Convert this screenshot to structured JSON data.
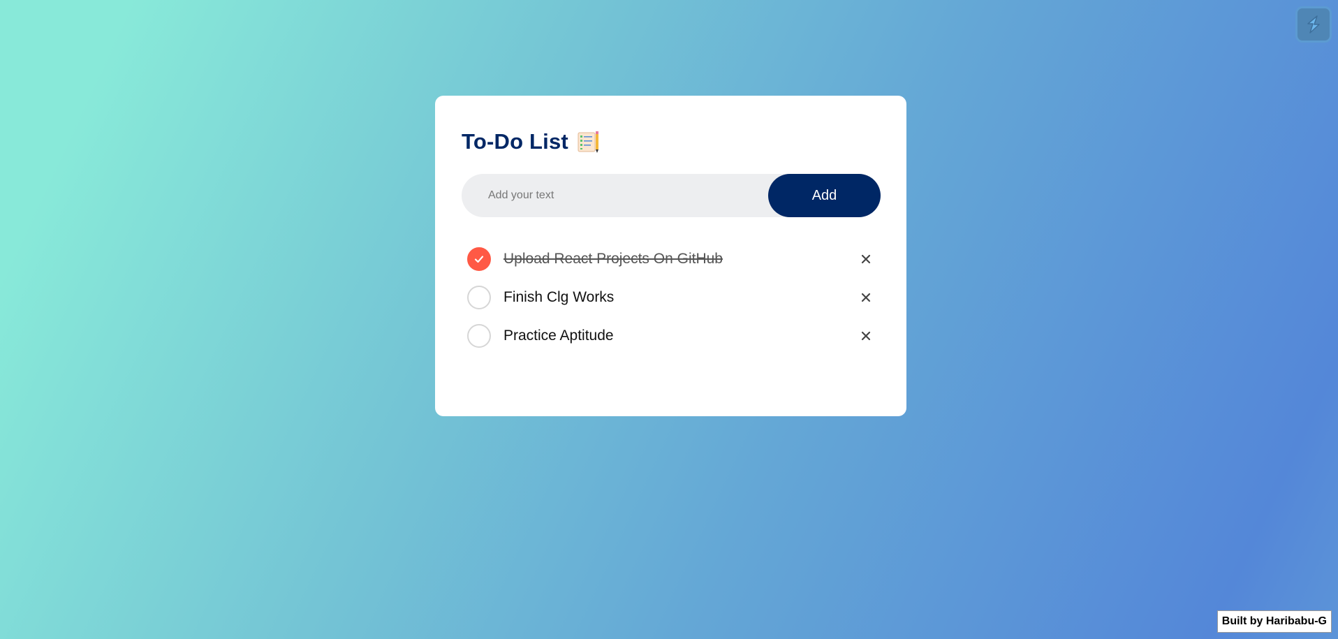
{
  "header": {
    "title": "To-Do List",
    "title_icon": "notepad-pencil-icon"
  },
  "form": {
    "placeholder": "Add your text",
    "value": "",
    "add_label": "Add"
  },
  "tasks": [
    {
      "text": "Upload React Projects On GitHub",
      "completed": true
    },
    {
      "text": "Finish Clg Works",
      "completed": false
    },
    {
      "text": "Practice Aptitude",
      "completed": false
    }
  ],
  "floating_button": {
    "icon": "lightning-logo-icon"
  },
  "footer": {
    "credit": "Built by Haribabu-G"
  },
  "colors": {
    "accent": "#002765",
    "check": "#ff5945",
    "card": "#ffffff",
    "input_bg": "#edeef0"
  }
}
